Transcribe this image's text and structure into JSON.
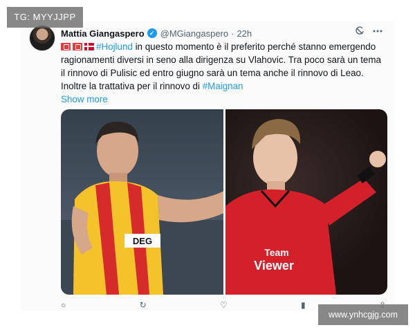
{
  "tweet": {
    "display_name": "Mattia Giangaspero",
    "handle": "@MGiangaspero",
    "separator": "·",
    "time": "22h",
    "flag_icons": [
      "flag-icon",
      "flag-icon",
      "denmark-flag-icon"
    ],
    "hashtag_1": "#Hojlund",
    "text_1": " in questo momento è il preferito perché stanno emergendo ragionamenti diversi in seno alla dirigenza su Vlahovic. Tra poco sarà un tema il rinnovo di Pulisic ed entro giugno sarà un tema anche il rinnovo di Leao. Inoltre la trattativa per il rinnovo di ",
    "hashtag_2": "#Maignan",
    "show_more": "Show more"
  },
  "media": {
    "left_photo": {
      "description_icon": "player-photo",
      "sponsor_text": "DEG",
      "kit_colors": [
        "#f4c22b",
        "#d62b2b"
      ]
    },
    "right_photo": {
      "description_icon": "player-photo",
      "sponsor_line_1": "Team",
      "sponsor_line_2": "Viewer",
      "kit_color": "#d4202a"
    }
  },
  "overlays": {
    "top_left": "TG: MYYJJPP",
    "bottom_right": "www.ynhcgjg.com"
  },
  "colors": {
    "link": "#1d9bf0",
    "text": "#0f1419",
    "muted": "#536471"
  }
}
